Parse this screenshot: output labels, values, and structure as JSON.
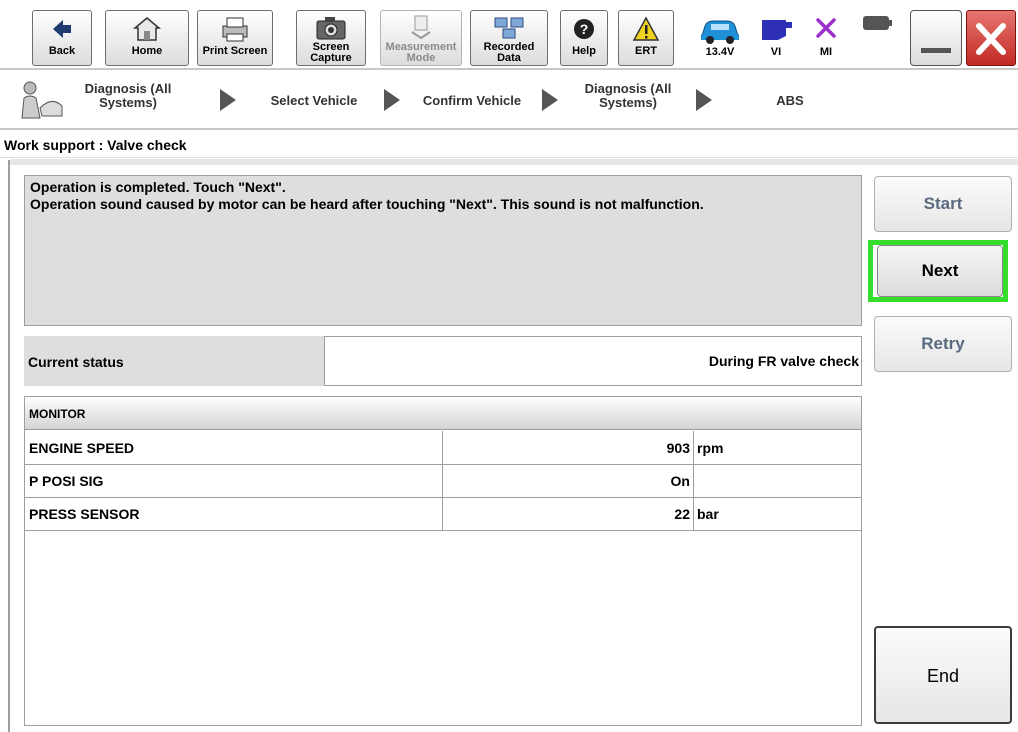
{
  "toolbar": {
    "back": "Back",
    "home": "Home",
    "print_screen": "Print Screen",
    "screen_capture_1": "Screen",
    "screen_capture_2": "Capture",
    "measurement_mode_1": "Measurement",
    "measurement_mode_2": "Mode",
    "recorded_data_1": "Recorded",
    "recorded_data_2": "Data",
    "help": "Help",
    "ert": "ERT",
    "voltage": "13.4V",
    "vi": "VI",
    "mi": "MI"
  },
  "breadcrumb": {
    "item1_line1": "Diagnosis (All",
    "item1_line2": "Systems)",
    "item2": "Select Vehicle",
    "item3": "Confirm Vehicle",
    "item4_line1": "Diagnosis (All",
    "item4_line2": "Systems)",
    "item5": "ABS"
  },
  "page_title": "Work support : Valve check",
  "message": {
    "line1": "Operation is completed. Touch \"Next\".",
    "line2": "Operation sound caused by motor can be heard after touching \"Next\". This sound is not malfunction."
  },
  "status": {
    "label": "Current status",
    "value": "During FR valve check"
  },
  "monitor": {
    "header": "MONITOR",
    "rows": [
      {
        "name": "ENGINE SPEED",
        "value": "903",
        "unit": "rpm"
      },
      {
        "name": "P POSI SIG",
        "value": "On",
        "unit": ""
      },
      {
        "name": "PRESS SENSOR",
        "value": "22",
        "unit": "bar"
      }
    ]
  },
  "buttons": {
    "start": "Start",
    "next": "Next",
    "retry": "Retry",
    "end": "End"
  },
  "icons": {
    "back": "back-arrow-icon",
    "home": "home-icon",
    "print": "printer-icon",
    "camera": "camera-icon",
    "measurement": "measurement-icon",
    "recorded": "recorded-data-icon",
    "help": "help-icon",
    "ert": "warning-icon",
    "car": "car-battery-voltage-icon",
    "vi": "vehicle-interface-icon",
    "mi": "mi-icon",
    "battery": "battery-icon",
    "minimize": "minimize-icon",
    "close": "close-icon"
  },
  "colors": {
    "highlight": "#35dd2c",
    "close_red": "#d9403a",
    "panel_gray": "#dedede"
  }
}
